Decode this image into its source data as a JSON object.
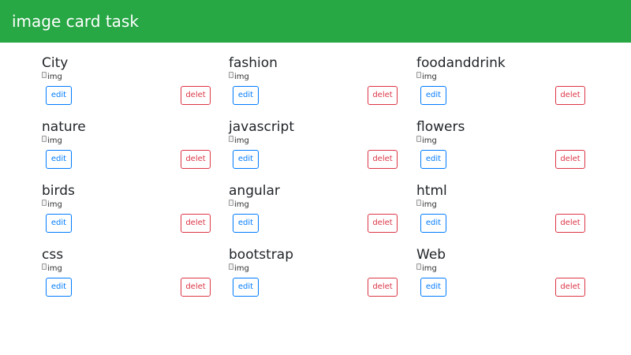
{
  "navbar": {
    "brand": "image card task"
  },
  "cards": [
    {
      "title": "City",
      "img_alt": "img",
      "edit_label": "edit",
      "delete_label": "delet"
    },
    {
      "title": "fashion",
      "img_alt": "img",
      "edit_label": "edit",
      "delete_label": "delet"
    },
    {
      "title": "foodanddrink",
      "img_alt": "img",
      "edit_label": "edit",
      "delete_label": "delet"
    },
    {
      "title": "nature",
      "img_alt": "img",
      "edit_label": "edit",
      "delete_label": "delet"
    },
    {
      "title": "javascript",
      "img_alt": "img",
      "edit_label": "edit",
      "delete_label": "delet"
    },
    {
      "title": "flowers",
      "img_alt": "img",
      "edit_label": "edit",
      "delete_label": "delet"
    },
    {
      "title": "birds",
      "img_alt": "img",
      "edit_label": "edit",
      "delete_label": "delet"
    },
    {
      "title": "angular",
      "img_alt": "img",
      "edit_label": "edit",
      "delete_label": "delet"
    },
    {
      "title": "html",
      "img_alt": "img",
      "edit_label": "edit",
      "delete_label": "delet"
    },
    {
      "title": "css",
      "img_alt": "img",
      "edit_label": "edit",
      "delete_label": "delet"
    },
    {
      "title": "bootstrap",
      "img_alt": "img",
      "edit_label": "edit",
      "delete_label": "delet"
    },
    {
      "title": "Web",
      "img_alt": "img",
      "edit_label": "edit",
      "delete_label": "delet"
    }
  ],
  "colors": {
    "navbar_bg": "#28a745",
    "edit_accent": "#007bff",
    "delete_accent": "#dc3545"
  }
}
